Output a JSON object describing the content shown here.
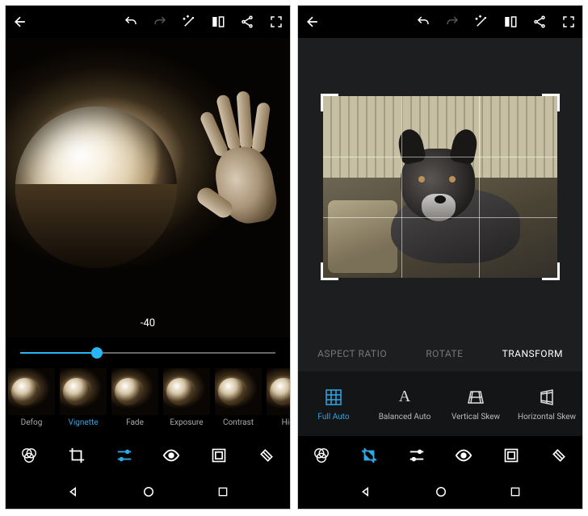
{
  "left": {
    "topbar": {
      "back": "←",
      "undo": "↶",
      "redo": "↷",
      "wand": "magic",
      "compare": "compare",
      "share": "share",
      "fullscreen": "fullscreen"
    },
    "value_readout": "-40",
    "slider": {
      "min": -100,
      "max": 100,
      "value": -40,
      "fill_pct": 30
    },
    "filmstrip": [
      {
        "label": "Defog",
        "active": false
      },
      {
        "label": "Vignette",
        "active": true
      },
      {
        "label": "Fade",
        "active": false
      },
      {
        "label": "Exposure",
        "active": false
      },
      {
        "label": "Contrast",
        "active": false
      },
      {
        "label": "High",
        "active": false
      }
    ],
    "toolbar": [
      {
        "id": "effects",
        "active": false
      },
      {
        "id": "crop",
        "active": false
      },
      {
        "id": "adjust",
        "active": true
      },
      {
        "id": "redeye",
        "active": false
      },
      {
        "id": "frames",
        "active": false
      },
      {
        "id": "heal",
        "active": false
      }
    ]
  },
  "right": {
    "topbar": {
      "back": "←",
      "undo": "↶",
      "redo": "↷",
      "wand": "magic",
      "compare": "compare",
      "share": "share",
      "fullscreen": "fullscreen"
    },
    "crop_tabs": [
      {
        "label": "ASPECT RATIO",
        "active": false
      },
      {
        "label": "ROTATE",
        "active": false
      },
      {
        "label": "TRANSFORM",
        "active": true
      }
    ],
    "transform_options": [
      {
        "label": "Full Auto",
        "active": true,
        "icon": "grid"
      },
      {
        "label": "Balanced Auto",
        "active": false,
        "icon": "A"
      },
      {
        "label": "Vertical Skew",
        "active": false,
        "icon": "vskew"
      },
      {
        "label": "Horizontal Skew",
        "active": false,
        "icon": "hskew"
      }
    ],
    "toolbar": [
      {
        "id": "effects",
        "active": false
      },
      {
        "id": "crop",
        "active": true
      },
      {
        "id": "adjust",
        "active": false
      },
      {
        "id": "redeye",
        "active": false
      },
      {
        "id": "frames",
        "active": false
      },
      {
        "id": "heal",
        "active": false
      }
    ]
  },
  "nav": {
    "back": "◁",
    "home": "○",
    "recents": "□"
  }
}
